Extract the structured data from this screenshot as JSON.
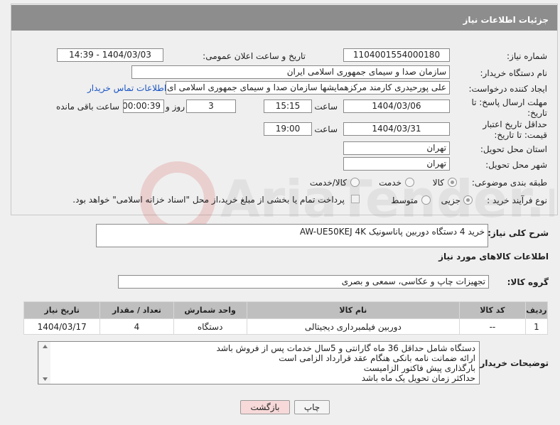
{
  "header": {
    "title": "جزئیات اطلاعات نیاز"
  },
  "fields": {
    "need_number_label": "شماره نیاز:",
    "need_number": "1104001554000180",
    "announce_label": "تاریخ و ساعت اعلان عمومی:",
    "announce_value": "1404/03/03 - 14:39",
    "buyer_org_label": "نام دستگاه خریدار:",
    "buyer_org": "سازمان صدا و سیمای جمهوری اسلامی ایران",
    "requester_label": "ایجاد کننده درخواست:",
    "requester": "علی پورحیدری کارمند مرکزهمایشها سازمان صدا و سیمای جمهوری اسلامی ای",
    "contact_link": "اطلاعات تماس خریدار",
    "deadline_label": "مهلت ارسال پاسخ: تا تاریخ:",
    "deadline_date": "1404/03/06",
    "time_label": "ساعت",
    "deadline_time": "15:15",
    "days_value": "3",
    "days_label": "روز و",
    "remaining_value": "00:00:39",
    "remaining_label": "ساعت باقی مانده",
    "price_validity_label": "حداقل تاریخ اعتبار قیمت: تا تاریخ:",
    "price_validity_date": "1404/03/31",
    "price_validity_time": "19:00",
    "province_label": "استان محل تحویل:",
    "province": "تهران",
    "city_label": "شهر محل تحویل:",
    "city": "تهران",
    "category_label": "طبقه بندی موضوعی:",
    "category_options": [
      "کالا",
      "خدمت",
      "کالا/خدمت"
    ],
    "purchase_type_label": "نوع فرآیند خرید :",
    "purchase_options": [
      "جزیی",
      "متوسط"
    ],
    "payment_note": "پرداخت تمام یا بخشی از مبلغ خرید،از محل \"اسناد خزانه اسلامی\" خواهد بود."
  },
  "description": {
    "label": "شرح کلی نیاز:",
    "value": "خرید 4 دستگاه دوربین پاناسونیک AW-UE50KEJ 4K"
  },
  "goods_section_title": "اطلاعات کالاهای مورد نیاز",
  "goods_group": {
    "label": "گروه کالا:",
    "value": "تجهیزات چاپ و عکاسی، سمعی و بصری"
  },
  "table": {
    "headers": [
      "ردیف",
      "کد کالا",
      "نام کالا",
      "واحد شمارش",
      "تعداد / مقدار",
      "تاریخ نیاز"
    ],
    "rows": [
      [
        "1",
        "--",
        "دوربین فیلمبرداری دیجیتالی",
        "دستگاه",
        "4",
        "1404/03/17"
      ]
    ]
  },
  "buyer_notes": {
    "label": "توضیحات خریدار:",
    "lines": [
      "دستگاه شامل حداقل 36 ماه گارانتی و  5سال خدمات پس از فروش باشد",
      "ارائه ضمانت نامه بانکی هنگام عقد قرارداد الزامی است",
      "بارگذاری پیش فاکتور الزامیست",
      "حداکثر زمان تحویل یک ماه باشد"
    ]
  },
  "buttons": {
    "print": "چاپ",
    "back": "بازگشت"
  },
  "watermark_text": "AriaTender.neT",
  "colors": {
    "header": "#8d8d8d",
    "link": "#1a55c4",
    "back_button": "#f7d9d9"
  }
}
